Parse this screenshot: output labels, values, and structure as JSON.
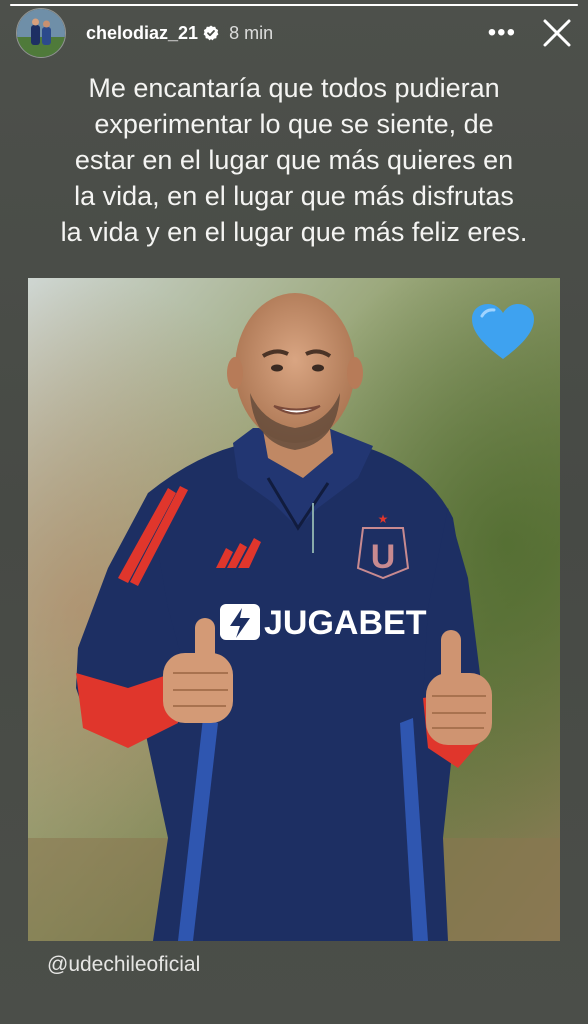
{
  "story": {
    "progress": 1.0,
    "username": "chelodiaz_21",
    "verified": true,
    "time": "8 min",
    "more_label": "•••",
    "caption_lines": [
      "Me encantaría que todos pudieran",
      "experimentar lo que se siente, de",
      "estar en el lugar que más quieres en",
      "la vida, en el lugar que más disfrutas",
      "la vida y en el lugar que más feliz eres."
    ],
    "photo": {
      "jersey_text": "JUGABET",
      "crest_letter": "U"
    },
    "sticker": "blue-heart",
    "mention": "@udechileoficial"
  },
  "colors": {
    "background": "#4a4d48",
    "jersey": "#1d2f63",
    "sleeve": "#e0362c",
    "heart": "#3ea2f0"
  }
}
